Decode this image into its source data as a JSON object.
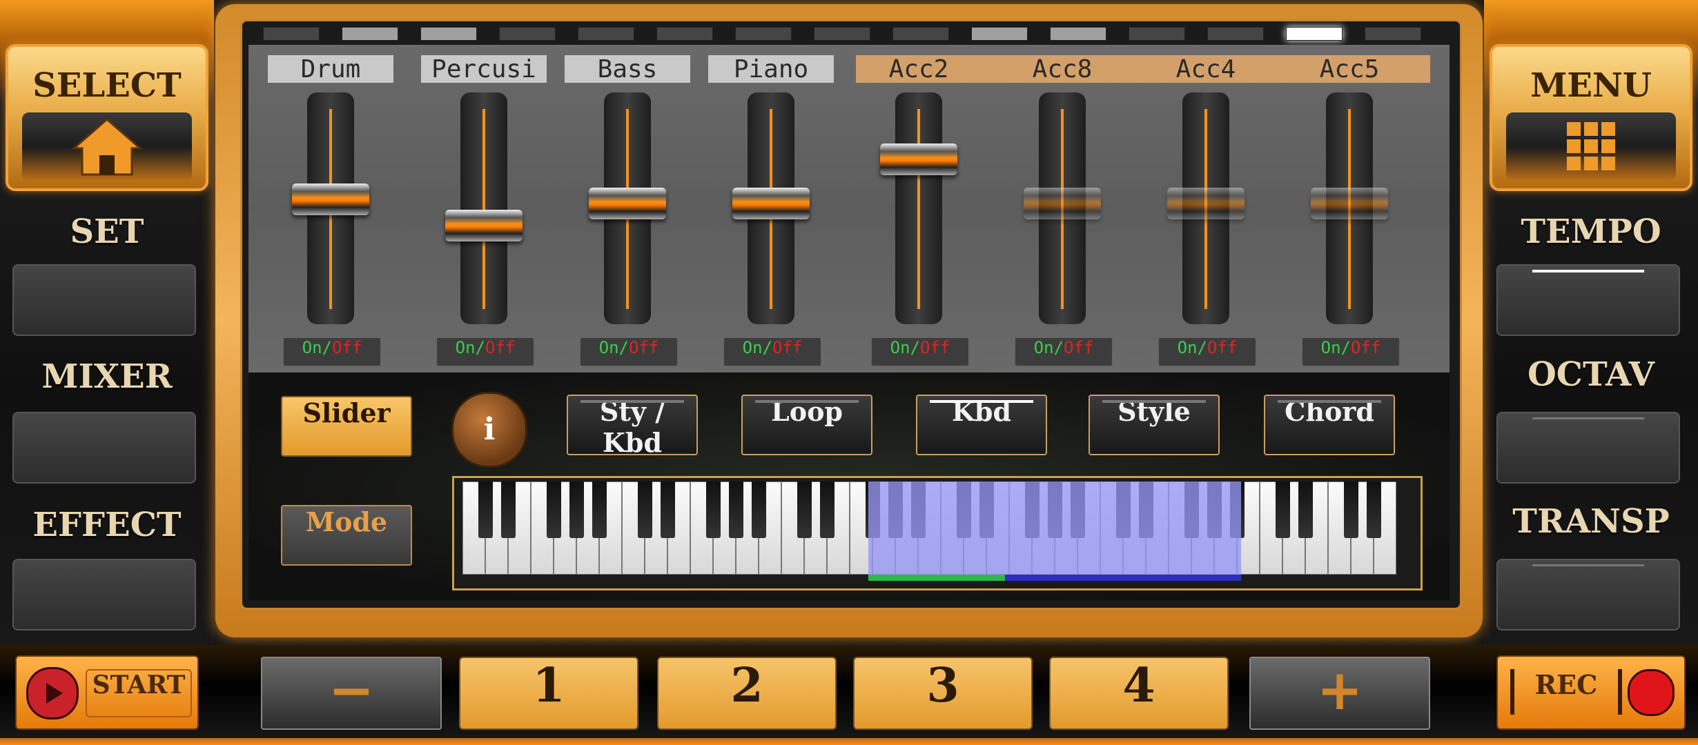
{
  "left_panel": {
    "select_label": "SELECT",
    "set_label": "SET",
    "mixer_label": "MIXER",
    "effect_label": "EFFECT"
  },
  "right_panel": {
    "menu_label": "MENU",
    "tempo_label": "TEMPO",
    "octav_label": "OCTAV",
    "transp_label": "TRANSP"
  },
  "mixer": {
    "channels": [
      {
        "label": "Drum",
        "level": 0.52,
        "active": true
      },
      {
        "label": "Percusi",
        "level": 0.39,
        "active": true
      },
      {
        "label": "Bass",
        "level": 0.5,
        "active": true
      },
      {
        "label": "Piano",
        "level": 0.5,
        "active": true
      },
      {
        "label": "Acc2",
        "level": 0.72,
        "active": true
      },
      {
        "label": "Acc8",
        "level": 0.5,
        "active": false
      },
      {
        "label": "Acc4",
        "level": 0.5,
        "active": false
      },
      {
        "label": "Acc5",
        "level": 0.5,
        "active": false
      }
    ],
    "onoff": {
      "on": "On",
      "sep": "/",
      "off": "Off"
    }
  },
  "controls": {
    "slider_label": "Slider",
    "info_label": "i",
    "sty_kbd_label": "Sty / Kbd",
    "loop_label": "Loop",
    "kbd_label": "Kbd",
    "style_label": "Style",
    "chord_label": "Chord",
    "mode_label": "Mode"
  },
  "bottom": {
    "start_label": "START",
    "minus_label": "−",
    "numbers": [
      "1",
      "2",
      "3",
      "4"
    ],
    "plus_label": "+",
    "rec_label": "REC"
  },
  "colors": {
    "accent": "#f2941c",
    "on_green": "#39d04a",
    "off_red": "#e02424",
    "keyboard_range": "#9696f5"
  },
  "icons": [
    "home-icon",
    "grid-icon",
    "play-icon",
    "record-icon"
  ]
}
